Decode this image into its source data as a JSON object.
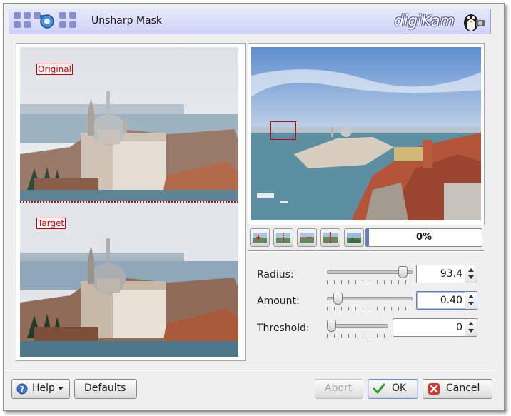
{
  "banner": {
    "title": "Unsharp Mask",
    "brand": "digiKam"
  },
  "preview": {
    "original_label": "Original",
    "target_label": "Target"
  },
  "toolbar": {
    "buttons": [
      "original-image-icon",
      "split-vertical-icon",
      "split-horizontal-icon",
      "separate-vertical-icon",
      "target-image-icon"
    ],
    "progress_text": "0%",
    "progress_value": 0
  },
  "params": {
    "radius": {
      "label": "Radius:",
      "value": "93.4",
      "level": 0.934
    },
    "amount": {
      "label": "Amount:",
      "value": "0.40",
      "level": 0.08
    },
    "threshold": {
      "label": "Threshold:",
      "value": "0",
      "level": 0.0
    }
  },
  "buttons": {
    "help": "Help",
    "defaults": "Defaults",
    "abort": "Abort",
    "ok": "OK",
    "cancel": "Cancel"
  },
  "colors": {
    "accent": "#5b7fc0",
    "guide": "#d40000",
    "banner": "#cfd3f6"
  }
}
